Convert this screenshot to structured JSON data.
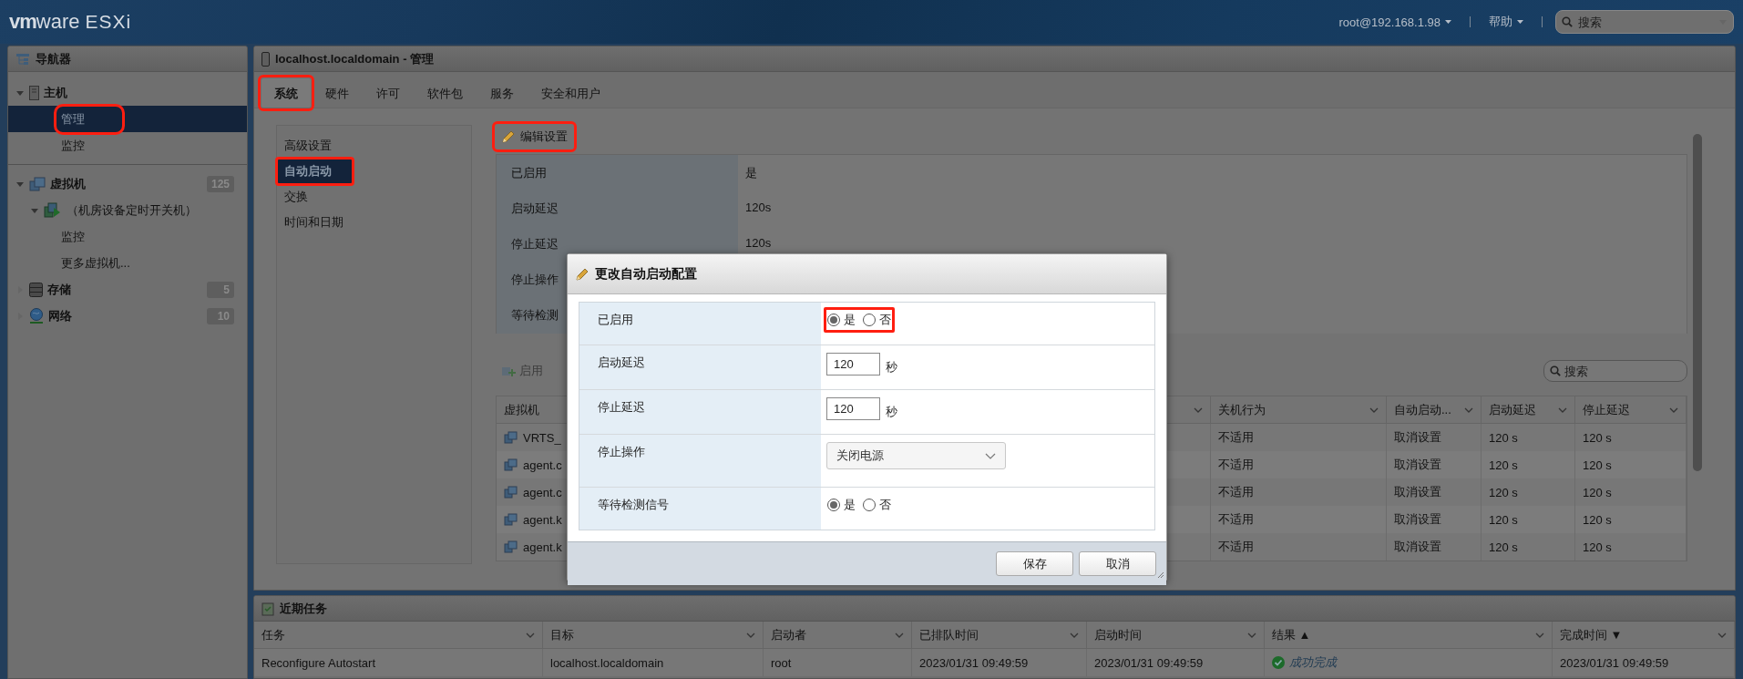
{
  "header": {
    "brand": "vm",
    "brand_rest": "ware",
    "product": "ESXi",
    "user_menu": "root@192.168.1.98",
    "help_menu": "帮助",
    "search": {
      "placeholder": "搜索"
    }
  },
  "navigator": {
    "title": "导航器",
    "items": [
      {
        "label": "主机",
        "kind": "host",
        "expanded": true,
        "children": [
          {
            "label": "管理",
            "kind": "leaf",
            "selected": true,
            "marked": true
          },
          {
            "label": "监控",
            "kind": "leaf",
            "selected": false,
            "marked": false
          }
        ]
      },
      {
        "label": "虚拟机",
        "kind": "vms",
        "count": "125",
        "expanded": true,
        "children": [
          {
            "label": "（机房设备定时开关机）",
            "kind": "vm",
            "expanded": true
          },
          {
            "label": "监控",
            "kind": "leaf",
            "selected": false,
            "marked": false
          },
          {
            "label": "更多虚拟机...",
            "kind": "leaf",
            "selected": false,
            "marked": false
          }
        ]
      },
      {
        "label": "存储",
        "kind": "storage",
        "count": "5",
        "expanded": false
      },
      {
        "label": "网络",
        "kind": "network",
        "count": "10",
        "expanded": false
      }
    ]
  },
  "main": {
    "title": "localhost.localdomain - 管理",
    "tabs": [
      {
        "label": "系统",
        "selected": true,
        "marked": true
      },
      {
        "label": "硬件",
        "selected": false,
        "marked": false
      },
      {
        "label": "许可",
        "selected": false,
        "marked": false
      },
      {
        "label": "软件包",
        "selected": false,
        "marked": false
      },
      {
        "label": "服务",
        "selected": false,
        "marked": false
      },
      {
        "label": "安全和用户",
        "selected": false,
        "marked": false
      }
    ],
    "subnav": [
      {
        "label": "高级设置",
        "selected": false,
        "marked": false
      },
      {
        "label": "自动启动",
        "selected": true,
        "marked": true
      },
      {
        "label": "交换",
        "selected": false,
        "marked": false
      },
      {
        "label": "时间和日期",
        "selected": false,
        "marked": false
      }
    ],
    "edit_button": {
      "label": "编辑设置",
      "marked": true
    },
    "settings": [
      {
        "label": "已启用",
        "value": "是"
      },
      {
        "label": "启动延迟",
        "value": "120s"
      },
      {
        "label": "停止延迟",
        "value": "120s"
      },
      {
        "label": "停止操作"
      },
      {
        "label": "等待检测"
      }
    ],
    "toolbar": {
      "enable_button": {
        "label": "启用",
        "disabled": true
      },
      "search": {
        "placeholder": "搜索"
      }
    },
    "vm_table": {
      "columns": [
        {
          "label": "虚拟机"
        },
        {
          "label": "关机行为"
        },
        {
          "label": "自动启动..."
        },
        {
          "label": "启动延迟"
        },
        {
          "label": "停止延迟"
        }
      ],
      "rows": [
        {
          "cells": [
            "VRTS_",
            "不适用",
            "取消设置",
            "120 s",
            "120 s"
          ]
        },
        {
          "cells": [
            "agent.c",
            "不适用",
            "取消设置",
            "120 s",
            "120 s"
          ]
        },
        {
          "cells": [
            "agent.c",
            "不适用",
            "取消设置",
            "120 s",
            "120 s"
          ]
        },
        {
          "cells": [
            "agent.k",
            "不适用",
            "取消设置",
            "120 s",
            "120 s"
          ]
        },
        {
          "cells": [
            "agent.k",
            "不适用",
            "取消设置",
            "120 s",
            "120 s"
          ]
        }
      ]
    }
  },
  "dialog": {
    "title": "更改自动启动配置",
    "rows": [
      {
        "label": "已启用",
        "kind": "radio",
        "marked": true,
        "options": [
          {
            "label": "是",
            "selected": true
          },
          {
            "label": "否",
            "selected": false
          }
        ]
      },
      {
        "label": "启动延迟",
        "kind": "number",
        "value": "120",
        "unit": "秒"
      },
      {
        "label": "停止延迟",
        "kind": "number",
        "value": "120",
        "unit": "秒"
      },
      {
        "label": "停止操作",
        "kind": "select",
        "value": "关闭电源"
      },
      {
        "label": "等待检测信号",
        "kind": "radio",
        "marked": false,
        "options": [
          {
            "label": "是",
            "selected": true
          },
          {
            "label": "否",
            "selected": false
          }
        ]
      }
    ],
    "buttons": [
      "保存",
      "取消"
    ]
  },
  "tasks": {
    "title": "近期任务",
    "columns": [
      "任务",
      "目标",
      "启动者",
      "已排队时间",
      "启动时间",
      "结果 ▲",
      "完成时间 ▼"
    ],
    "rows": [
      {
        "cells": [
          {
            "text": "Reconfigure Autostart"
          },
          {
            "text": "localhost.localdomain"
          },
          {
            "text": "root"
          },
          {
            "text": "2023/01/31 09:49:59"
          },
          {
            "text": "2023/01/31 09:49:59"
          },
          {
            "text": "成功完成",
            "kind": "success"
          },
          {
            "text": "2023/01/31 09:49:59"
          }
        ]
      }
    ]
  }
}
